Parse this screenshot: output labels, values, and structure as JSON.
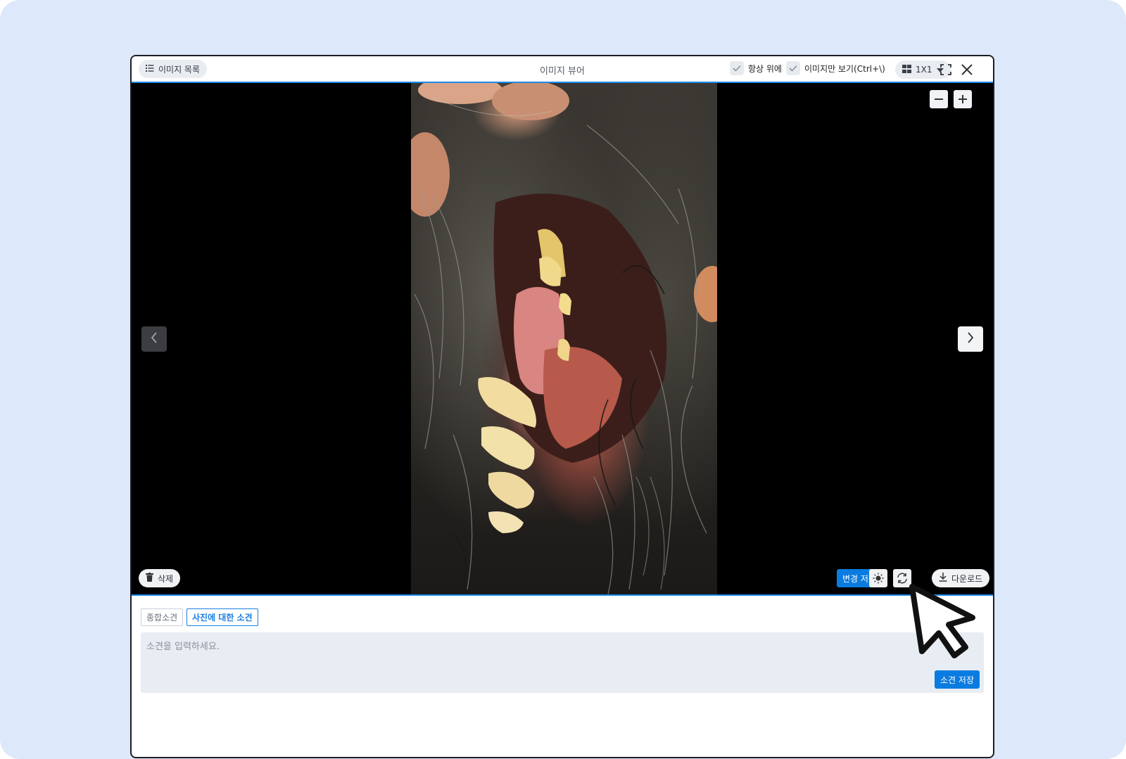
{
  "header": {
    "list_button_label": "이미지 목록",
    "title": "이미지 뷰어",
    "always_on_top_label": "항상 위에",
    "image_only_label": "이미지만 보기(Ctrl+\\)",
    "layout_label": "1X1"
  },
  "viewer": {
    "delete_label": "삭제",
    "save_changes_label": "변경 저장",
    "download_label": "다운로드"
  },
  "notes": {
    "tab_summary": "종합소견",
    "tab_photo": "사진에 대한 소견",
    "placeholder": "소견을 입력하세요.",
    "save_label": "소견 저장"
  },
  "colors": {
    "accent": "#0a7be0",
    "frame_bg": "#dde8fb"
  },
  "icons": [
    "list-icon",
    "check-icon",
    "grid-icon",
    "caret-down-icon",
    "fullscreen-icon",
    "close-icon",
    "zoom-out-icon",
    "zoom-in-icon",
    "chevron-left-icon",
    "chevron-right-icon",
    "trash-icon",
    "brightness-icon",
    "rotate-icon",
    "download-icon",
    "cursor-pointer"
  ]
}
